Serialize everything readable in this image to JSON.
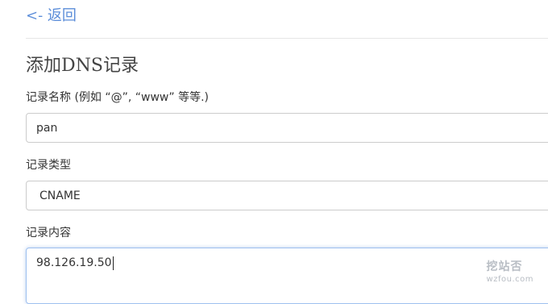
{
  "nav": {
    "back_label": "<- 返回"
  },
  "form": {
    "title": "添加DNS记录",
    "record_name": {
      "label": "记录名称 (例如 “@”, “www” 等等.)",
      "value": "pan"
    },
    "record_type": {
      "label": "记录类型",
      "value": "CNAME"
    },
    "record_content": {
      "label": "记录内容",
      "value": "98.126.19.50"
    }
  },
  "watermark": {
    "text": "挖站否",
    "subtext": "wzfou.com"
  },
  "colors": {
    "link": "#5b8dd9",
    "focus_border": "#9ec0ef",
    "watermark": "#b8bdc4"
  }
}
